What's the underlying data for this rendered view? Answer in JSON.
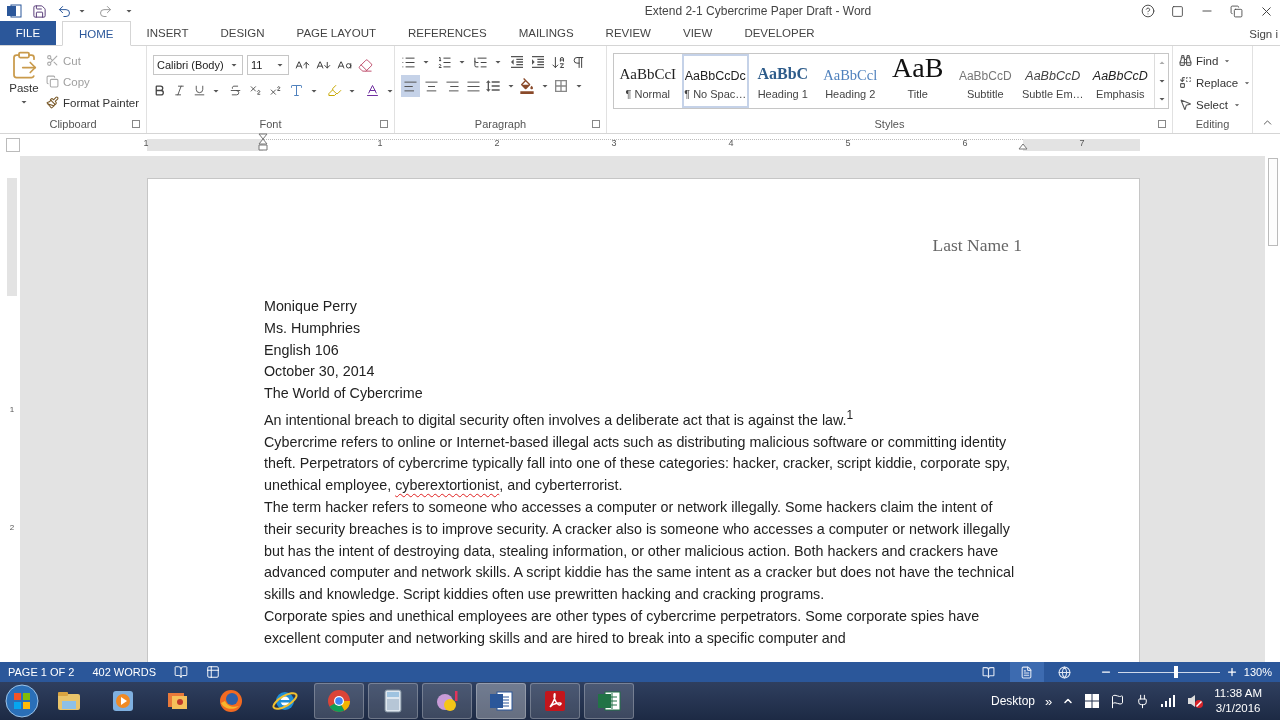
{
  "window": {
    "title": "Extend 2-1 Cybercrime Paper Draft - Word",
    "sign_in": "Sign i"
  },
  "file_tab": "FILE",
  "tabs": [
    {
      "label": "HOME",
      "selected": true
    },
    {
      "label": "INSERT",
      "selected": false
    },
    {
      "label": "DESIGN",
      "selected": false
    },
    {
      "label": "PAGE LAYOUT",
      "selected": false
    },
    {
      "label": "REFERENCES",
      "selected": false
    },
    {
      "label": "MAILINGS",
      "selected": false
    },
    {
      "label": "REVIEW",
      "selected": false
    },
    {
      "label": "VIEW",
      "selected": false
    },
    {
      "label": "DEVELOPER",
      "selected": false
    }
  ],
  "clipboard": {
    "label": "Clipboard",
    "paste": "Paste",
    "items": [
      {
        "kind": "cut",
        "label": "Cut",
        "disabled": true
      },
      {
        "kind": "copy",
        "label": "Copy",
        "disabled": true
      },
      {
        "kind": "painter",
        "label": "Format Painter",
        "disabled": false
      }
    ]
  },
  "font": {
    "label": "Font",
    "name": "Calibri (Body)",
    "size": "11"
  },
  "paragraph": {
    "label": "Paragraph",
    "alignment": [
      {
        "kind": "left",
        "selected": true
      },
      {
        "kind": "center",
        "selected": false
      },
      {
        "kind": "right",
        "selected": false
      },
      {
        "kind": "justify",
        "selected": false
      }
    ]
  },
  "styles": {
    "label": "Styles",
    "items": [
      {
        "kind": "normal",
        "preview": "AaBbCcI",
        "label": "¶ Normal",
        "selected": false
      },
      {
        "kind": "nospacing",
        "preview": "AaBbCcDc",
        "label": "¶ No Spac…",
        "selected": true
      },
      {
        "kind": "heading1",
        "preview": "AaBbC",
        "label": "Heading 1",
        "selected": false
      },
      {
        "kind": "heading2",
        "preview": "AaBbCcl",
        "label": "Heading 2",
        "selected": false
      },
      {
        "kind": "title",
        "preview": "AaB",
        "label": "Title",
        "selected": false
      },
      {
        "kind": "subtitle",
        "preview": "AaBbCcD",
        "label": "Subtitle",
        "selected": false
      },
      {
        "kind": "subtle",
        "preview": "AaBbCcD",
        "label": "Subtle Em…",
        "selected": false
      },
      {
        "kind": "emphasis",
        "preview": "AaBbCcD",
        "label": "Emphasis",
        "selected": false
      }
    ]
  },
  "editing": {
    "label": "Editing",
    "items": [
      {
        "kind": "find",
        "label": "Find"
      },
      {
        "kind": "replace",
        "label": "Replace"
      },
      {
        "kind": "select",
        "label": "Select"
      }
    ]
  },
  "ruler": {
    "labels": [
      "1",
      "1",
      "2",
      "3",
      "4",
      "5",
      "6",
      "7"
    ]
  },
  "vertical_ruler": {
    "labels": [
      "1",
      "2"
    ]
  },
  "document": {
    "header": "Last Name 1",
    "paragraphs": [
      {
        "segments": [
          {
            "text": "Monique Perry",
            "misspelled": false
          }
        ]
      },
      {
        "segments": [
          {
            "text": "Ms. Humphries",
            "misspelled": false
          }
        ]
      },
      {
        "segments": [
          {
            "text": "English 106",
            "misspelled": false
          }
        ]
      },
      {
        "segments": [
          {
            "text": "October 30, 2014",
            "misspelled": false
          }
        ]
      },
      {
        "segments": [
          {
            "text": "The World of Cybercrime",
            "misspelled": false
          }
        ]
      },
      {
        "segments": [
          {
            "text": "An intentional breach to digital security often involves a deliberate act that is against the law.$^{1}$",
            "misspelled": false
          }
        ]
      },
      {
        "segments": [
          {
            "text": "Cybercrime refers to online or Internet-based illegal acts such as distributing malicious software or committing identity theft. Perpetrators of cybercrime typically fall into one of these categories: hacker, cracker, script kiddie, corporate spy, unethical employee, ",
            "misspelled": false
          },
          {
            "text": "cyberextortionist",
            "misspelled": true
          },
          {
            "text": ", and cyberterrorist.",
            "misspelled": false
          }
        ]
      },
      {
        "segments": [
          {
            "text": "The term hacker refers to someone who accesses a computer or network illegally. Some hackers claim the intent of their security breaches is to improve security. A cracker also is someone who accesses a computer or network illegally but has the intent of destroying data, stealing information, or other malicious action. Both hackers and crackers have advanced computer and network skills. A script kiddie has the same intent as a cracker but does not have the technical skills and knowledge. Script kiddies often use prewritten hacking and cracking programs.",
            "misspelled": false
          }
        ]
      },
      {
        "segments": [
          {
            "text": "Corporate spies and unethical employees are other types of cybercrime perpetrators. Some corporate spies have excellent computer and networking skills and are hired to break into a specific computer and",
            "misspelled": false
          }
        ]
      }
    ]
  },
  "status_bar": {
    "page": "PAGE 1 OF 2",
    "words": "402 WORDS",
    "views": [
      {
        "kind": "read",
        "selected": false
      },
      {
        "kind": "print",
        "selected": true
      },
      {
        "kind": "web",
        "selected": false
      }
    ],
    "zoom": {
      "level": 0.57,
      "reading": "130%"
    }
  },
  "taskbar": {
    "apps": [
      {
        "kind": "explorer",
        "running": false,
        "selected": false
      },
      {
        "kind": "media",
        "running": false,
        "selected": false
      },
      {
        "kind": "photos",
        "running": false,
        "selected": false
      },
      {
        "kind": "firefox",
        "running": false,
        "selected": false
      },
      {
        "kind": "ie",
        "running": false,
        "selected": false
      },
      {
        "kind": "chrome",
        "running": true,
        "selected": false
      },
      {
        "kind": "calculator",
        "running": true,
        "selected": false
      },
      {
        "kind": "messenger",
        "running": true,
        "selected": false
      },
      {
        "kind": "word",
        "running": true,
        "selected": true
      },
      {
        "kind": "pdf",
        "running": true,
        "selected": false
      },
      {
        "kind": "excel",
        "running": true,
        "selected": false
      }
    ],
    "desktop": "Desktop",
    "chevron": "»",
    "time": "11:38 AM",
    "date": "3/1/2016"
  }
}
